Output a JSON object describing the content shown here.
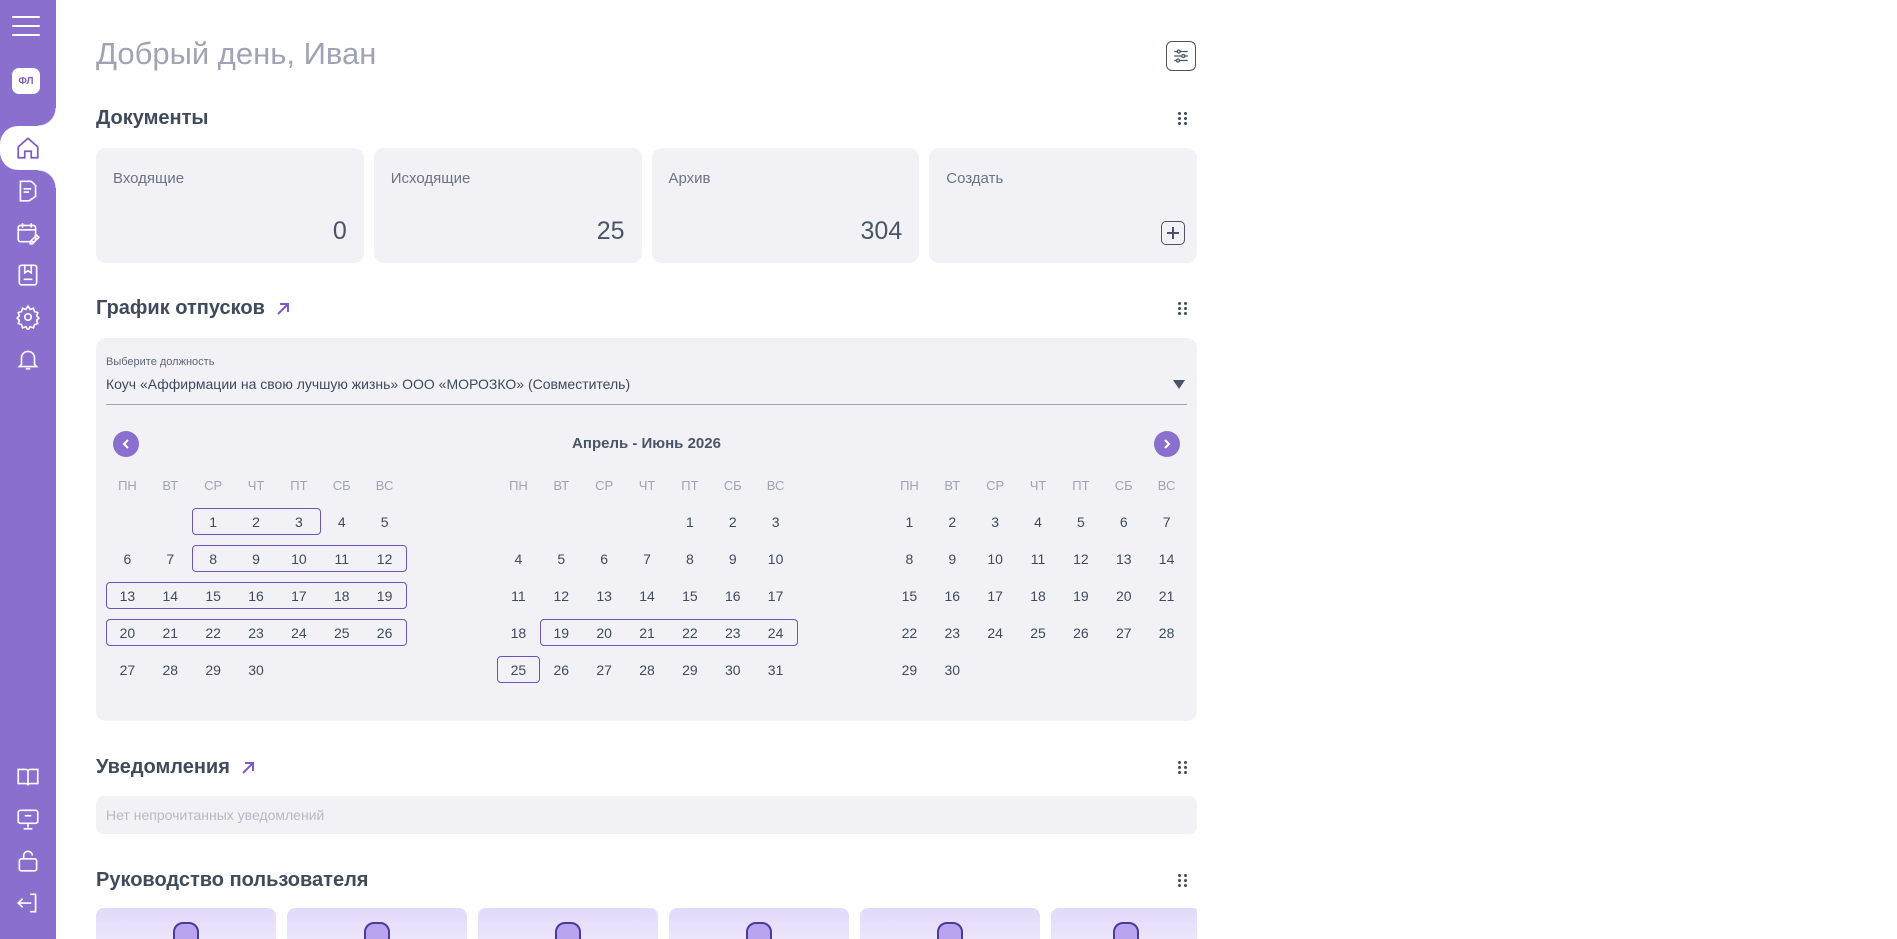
{
  "sidebar": {
    "avatar_initials": "ФЛ",
    "items": [
      {
        "icon": "home-icon"
      },
      {
        "icon": "documents-icon"
      },
      {
        "icon": "calendar-edit-icon"
      },
      {
        "icon": "book-icon"
      },
      {
        "icon": "gear-icon"
      },
      {
        "icon": "bell-icon"
      }
    ],
    "bottom_items": [
      {
        "icon": "open-book-icon"
      },
      {
        "icon": "monitor-chat-icon"
      },
      {
        "icon": "lock-icon"
      },
      {
        "icon": "logout-icon"
      }
    ]
  },
  "header": {
    "greeting": "Добрый день, Иван"
  },
  "documents": {
    "title": "Документы",
    "cards": [
      {
        "label": "Входящие",
        "value": "0"
      },
      {
        "label": "Исходящие",
        "value": "25"
      },
      {
        "label": "Архив",
        "value": "304"
      },
      {
        "label": "Создать",
        "value": ""
      }
    ]
  },
  "vacation": {
    "title": "График отпусков",
    "select_label": "Выберите должность",
    "select_value": "Коуч «Аффирмации на свою лучшую жизнь» ООО «МОРОЗКО» (Совместитель)",
    "period": "Апрель - Июнь 2026",
    "weekdays": [
      "ПН",
      "ВТ",
      "СР",
      "ЧТ",
      "ПТ",
      "СБ",
      "ВС"
    ],
    "months": [
      {
        "weeks": [
          [
            "",
            "",
            "1",
            "2",
            "3",
            "4",
            "5"
          ],
          [
            "6",
            "7",
            "8",
            "9",
            "10",
            "11",
            "12"
          ],
          [
            "13",
            "14",
            "15",
            "16",
            "17",
            "18",
            "19"
          ],
          [
            "20",
            "21",
            "22",
            "23",
            "24",
            "25",
            "26"
          ],
          [
            "27",
            "28",
            "29",
            "30",
            "",
            "",
            ""
          ]
        ],
        "holidays": []
      },
      {
        "weeks": [
          [
            "",
            "",
            "",
            "",
            "1",
            "2",
            "3"
          ],
          [
            "4",
            "5",
            "6",
            "7",
            "8",
            "9",
            "10"
          ],
          [
            "11",
            "12",
            "13",
            "14",
            "15",
            "16",
            "17"
          ],
          [
            "18",
            "19",
            "20",
            "21",
            "22",
            "23",
            "24"
          ],
          [
            "25",
            "26",
            "27",
            "28",
            "29",
            "30",
            "31"
          ]
        ],
        "holidays": [
          "1",
          "9"
        ]
      },
      {
        "weeks": [
          [
            "1",
            "2",
            "3",
            "4",
            "5",
            "6",
            "7"
          ],
          [
            "8",
            "9",
            "10",
            "11",
            "12",
            "13",
            "14"
          ],
          [
            "15",
            "16",
            "17",
            "18",
            "19",
            "20",
            "21"
          ],
          [
            "22",
            "23",
            "24",
            "25",
            "26",
            "27",
            "28"
          ],
          [
            "29",
            "30",
            "",
            "",
            "",
            "",
            ""
          ]
        ],
        "holidays": [
          "12"
        ]
      }
    ],
    "vacations": [
      {
        "month": 0,
        "week": 0,
        "from": 2,
        "to": 4
      },
      {
        "month": 0,
        "week": 1,
        "from": 2,
        "to": 6
      },
      {
        "month": 0,
        "week": 2,
        "from": 0,
        "to": 6
      },
      {
        "month": 0,
        "week": 3,
        "from": 0,
        "to": 6
      },
      {
        "month": 1,
        "week": 3,
        "from": 1,
        "to": 6
      },
      {
        "month": 1,
        "week": 4,
        "from": 0,
        "to": 0
      }
    ]
  },
  "notifications": {
    "title": "Уведомления",
    "empty_text": "Нет непрочитанных уведомлений"
  },
  "guide": {
    "title": "Руководство пользователя"
  },
  "colors": {
    "sidebar": "#8b6fcf",
    "card_bg": "#f2f2f6",
    "holiday": "#e53935",
    "vacation_border": "#6c55b8"
  }
}
